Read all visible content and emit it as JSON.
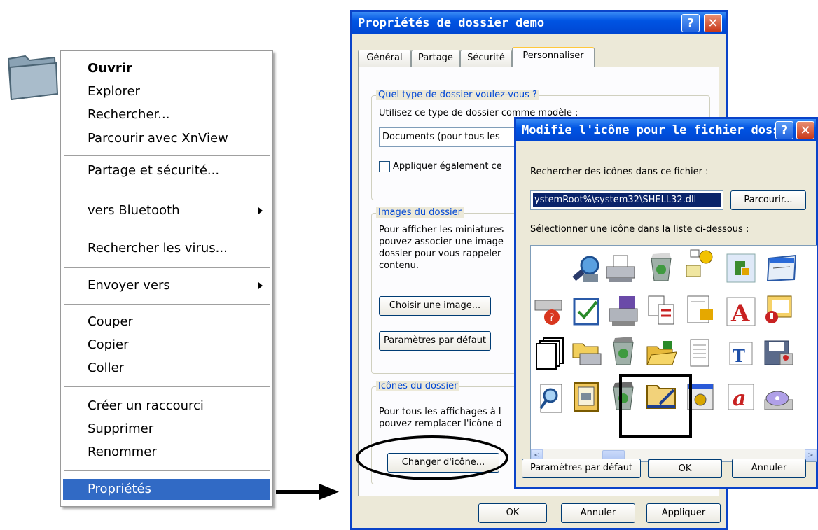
{
  "context_menu": {
    "items": [
      {
        "label": "Ouvrir"
      },
      {
        "label": "Explorer"
      },
      {
        "label": "Rechercher..."
      },
      {
        "label": "Parcourir avec XnView"
      },
      {
        "label": "Partage et sécurité..."
      },
      {
        "label": "vers Bluetooth"
      },
      {
        "label": "Rechercher les virus..."
      },
      {
        "label": "Envoyer vers"
      },
      {
        "label": "Couper"
      },
      {
        "label": "Copier"
      },
      {
        "label": "Coller"
      },
      {
        "label": "Créer un raccourci"
      },
      {
        "label": "Supprimer"
      },
      {
        "label": "Renommer"
      },
      {
        "label": "Propriétés"
      }
    ],
    "selected_item": "Propriétés",
    "selected_color": "#316ac5"
  },
  "properties_dialog": {
    "title": "Propriétés de dossier demo",
    "help": "?",
    "close": "✕",
    "tabs": [
      "Général",
      "Partage",
      "Sécurité",
      "Personnaliser"
    ],
    "active_tab": "Personnaliser",
    "group_type": {
      "title": "Quel type de dossier voulez-vous ?",
      "template_label": "Utilisez ce type de dossier comme modèle :",
      "template_value": "Documents (pour tous les",
      "apply_sub_label": "Appliquer également ce"
    },
    "group_images": {
      "title": "Images du dossier",
      "desc": [
        "Pour afficher les miniatures",
        "pouvez associer une image",
        "dossier pour vous rappeler",
        "contenu."
      ],
      "choose_button": "Choisir une image...",
      "default_button": "Paramètres par défaut"
    },
    "group_icons": {
      "title": "Icônes du dossier",
      "desc": [
        "Pour tous les affichages à l",
        "pouvez remplacer l'icône d"
      ],
      "change_button": "Changer d'icône..."
    },
    "ok": "OK",
    "cancel": "Annuler",
    "apply": "Appliquer"
  },
  "change_icon_dialog": {
    "title": "Modifie l'icône pour le fichier dossi...",
    "help": "?",
    "close": "✕",
    "search_label": "Rechercher des icônes dans ce fichier :",
    "file_value": "ystemRoot%\\system32\\SHELL32.dll",
    "browse_button": "Parcourir...",
    "select_label": "Sélectionner une icône dans la liste ci-dessous :",
    "default_button": "Paramètres par défaut",
    "ok": "OK",
    "cancel": "Annuler",
    "scroll_left": "<",
    "scroll_right": ">",
    "icons": [
      [
        "search-magnifier-icon",
        "printer-icon",
        "recycle-bin-full-icon",
        "network-setup-icon",
        "puzzle-icon",
        "window-icon"
      ],
      [
        "help-drive-icon",
        "checklist-icon",
        "fax-icon",
        "document-exchange-icon",
        "notepad-puzzle-icon",
        "font-a-icon",
        "file-error-icon"
      ],
      [
        "pages-stack-icon",
        "print-folder-icon",
        "recycle-bin-icon",
        "folder-open-icon",
        "text-document-icon",
        "font-t-icon",
        "floppy-icon"
      ],
      [
        "find-document-icon",
        "picture-frame-icon",
        "recycle-bin-empty-icon",
        "folder-edit-icon",
        "settings-window-icon",
        "font-a-italic-icon",
        "cd-icon"
      ]
    ]
  },
  "colors": {
    "titlebar": "#0054e3",
    "dialog_bg": "#ece9d8",
    "group_title": "#0046d5",
    "selection": "#0a246a"
  }
}
